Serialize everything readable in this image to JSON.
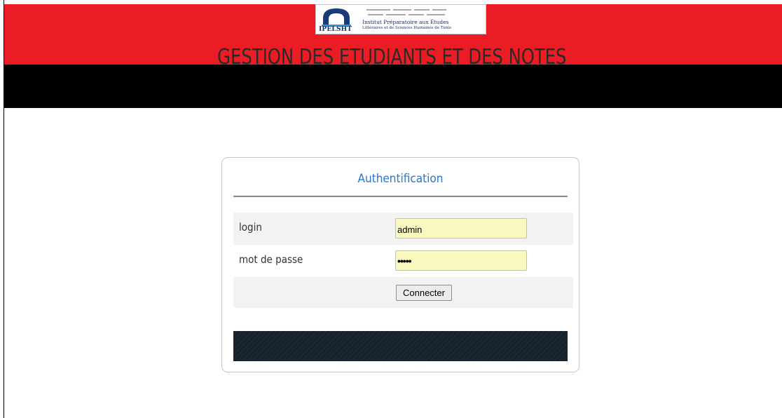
{
  "header": {
    "title": "GESTION DES ETUDIANTS ET DES NOTES",
    "colors": {
      "red": "#ec1c24",
      "black": "#000000"
    },
    "logo": {
      "acronym": "IPELSHT",
      "line1": "Institut Préparatoire aux Études",
      "line2": "Littéraires et de Sciences Humaines de Tunis",
      "icon": "arch-logo-icon"
    }
  },
  "login_form": {
    "title": "Authentification",
    "title_color": "#2878c8",
    "login_label": "login",
    "login_value": "admin",
    "password_label": "mot de passe",
    "password_value": "•••••",
    "submit_label": "Connecter",
    "field_bg": "#fafac0"
  }
}
